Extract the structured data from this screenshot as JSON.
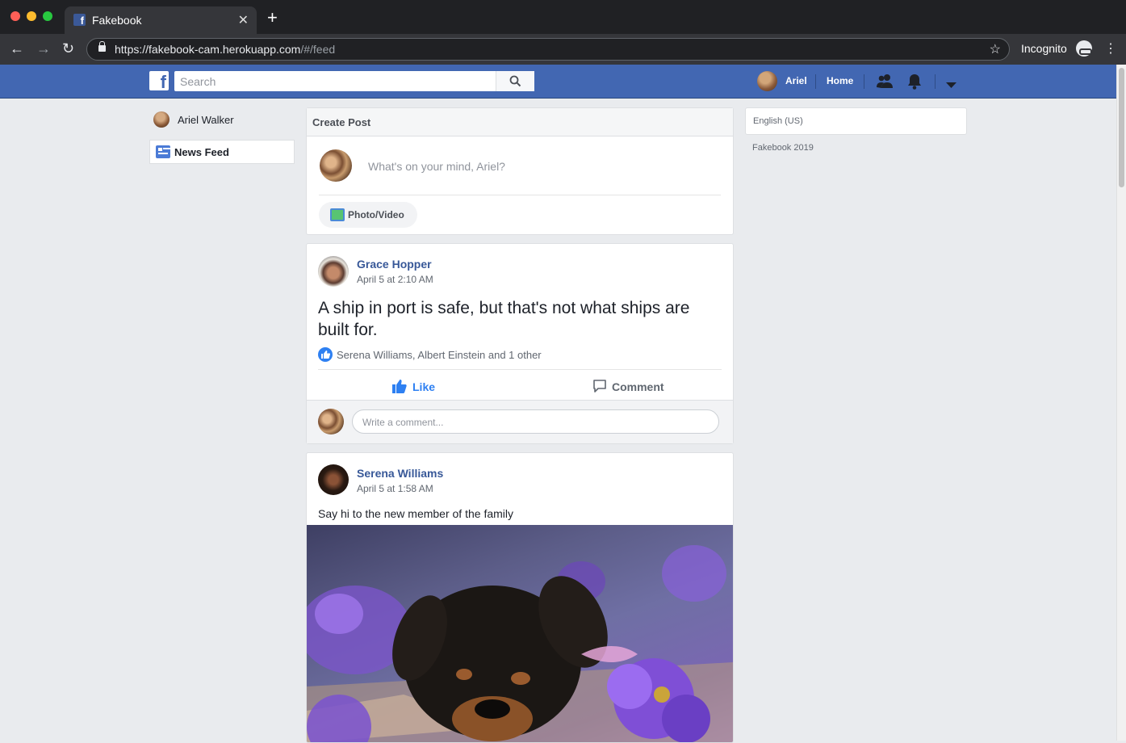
{
  "browser": {
    "tab_title": "Fakebook",
    "url_main": "https://fakebook-cam.herokuapp.com",
    "url_path": "/#/feed",
    "profile_label": "Incognito",
    "colors": {
      "close": "#ff5f57",
      "minimize": "#febc2e",
      "maximize": "#28c840"
    }
  },
  "header": {
    "search_placeholder": "Search",
    "user_name": "Ariel",
    "home_label": "Home",
    "brand_color": "#4267b2"
  },
  "left_nav": {
    "profile_name": "Ariel Walker",
    "items": [
      {
        "label": "News Feed",
        "icon": "news-feed-icon"
      }
    ]
  },
  "create_post": {
    "title": "Create Post",
    "prompt": "What's on your mind, Ariel?",
    "photo_video_label": "Photo/Video"
  },
  "posts": [
    {
      "author": "Grace Hopper",
      "time": "April 5 at 2:10 AM",
      "text": "A ship in port is safe, but that's not what ships are built for.",
      "likes_summary": "Serena Williams, Albert Einstein and 1 other",
      "like_label": "Like",
      "comment_label": "Comment",
      "comment_placeholder": "Write a comment..."
    },
    {
      "author": "Serena Williams",
      "time": "April 5 at 1:58 AM",
      "text": "Say hi to the new member of the family"
    }
  ],
  "right": {
    "language": "English (US)",
    "copyright": "Fakebook 2019"
  }
}
